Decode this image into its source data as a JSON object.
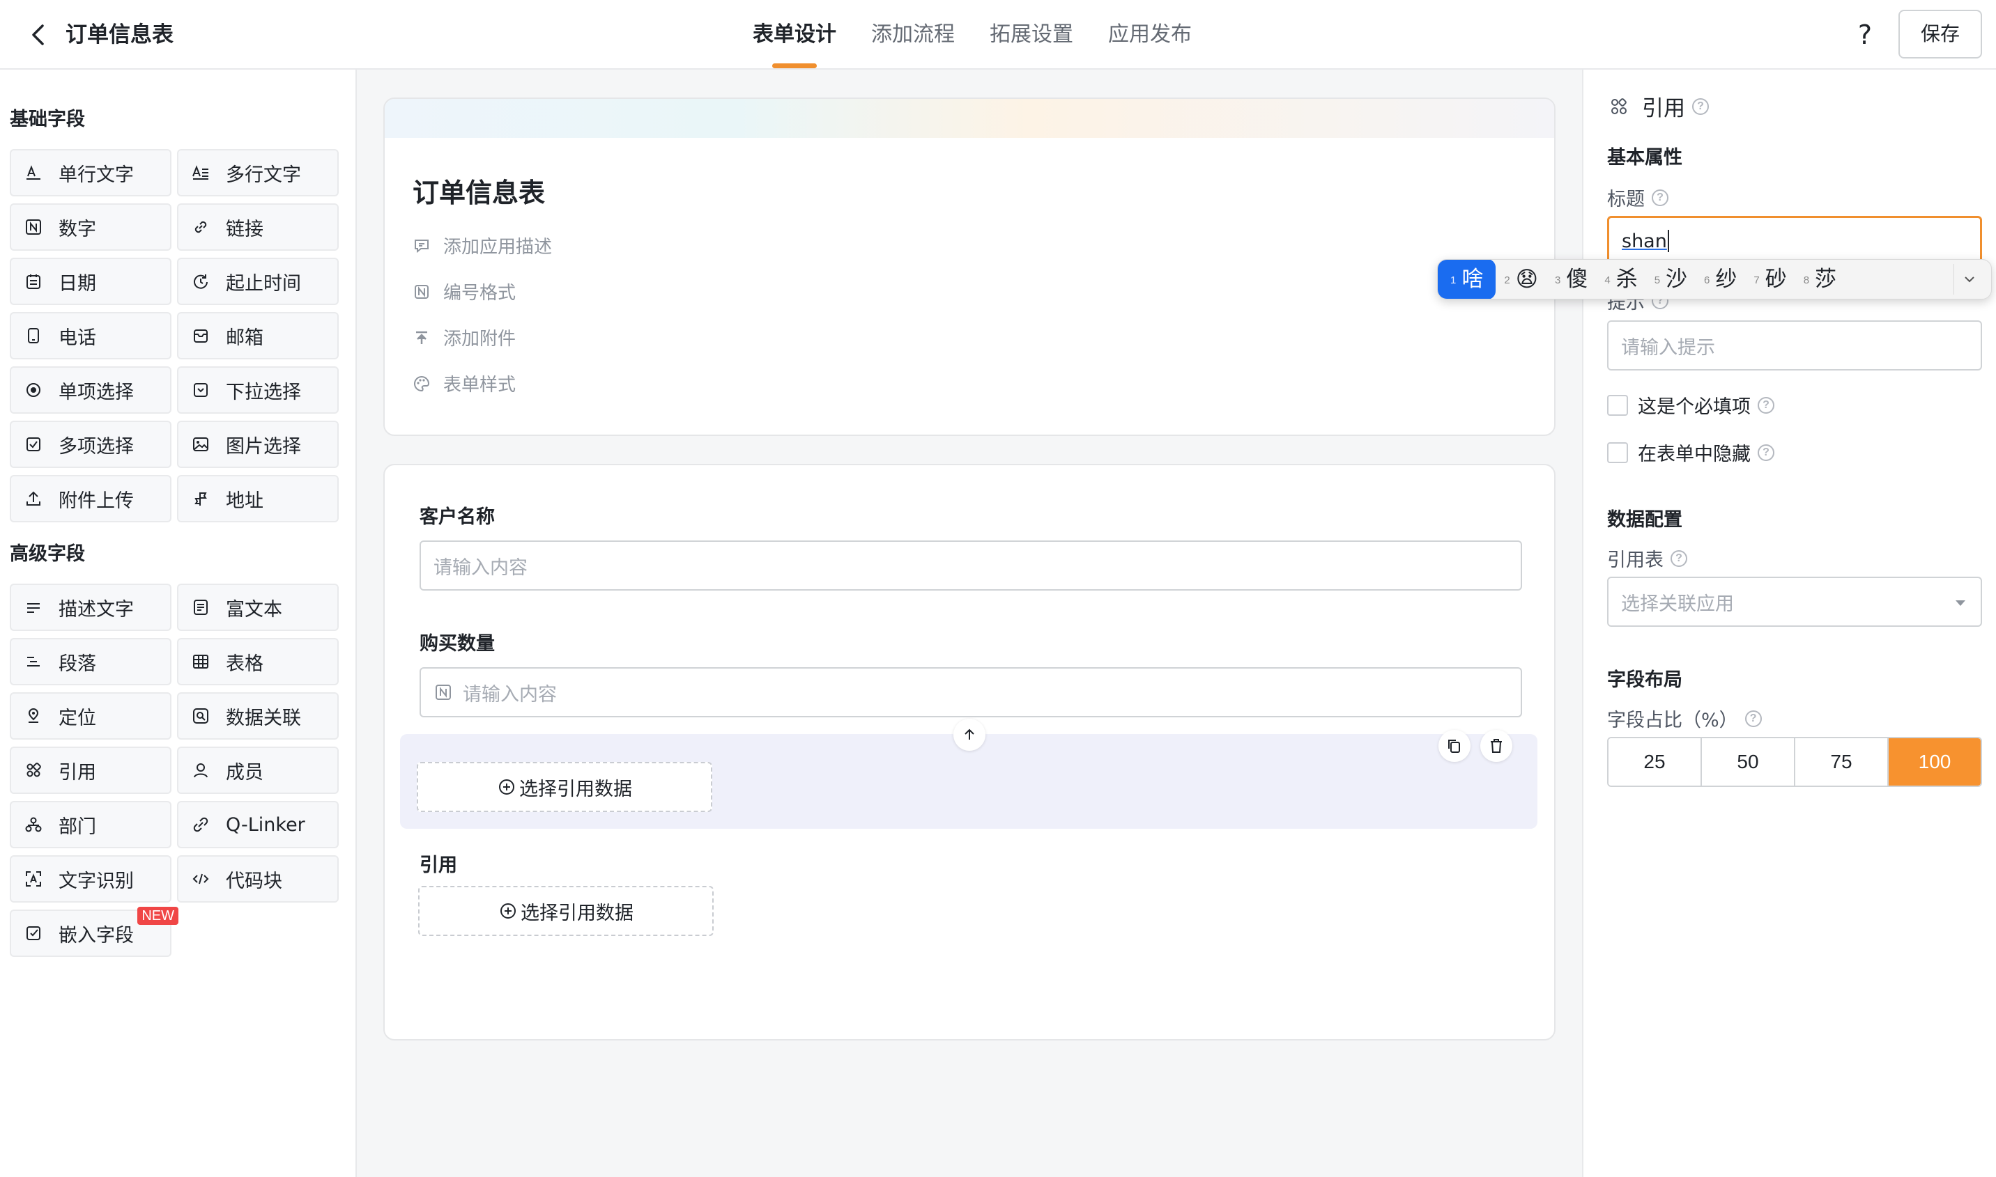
{
  "header": {
    "title": "订单信息表",
    "tabs": [
      {
        "label": "表单设计"
      },
      {
        "label": "添加流程"
      },
      {
        "label": "拓展设置"
      },
      {
        "label": "应用发布"
      }
    ],
    "active_tab": "表单设计",
    "help_label": "?",
    "save_label": "保存"
  },
  "left_panel": {
    "basic_title": "基础字段",
    "basic_fields": [
      {
        "label": "单行文字",
        "icon": "single-line-text-icon"
      },
      {
        "label": "多行文字",
        "icon": "multi-line-text-icon"
      },
      {
        "label": "数字",
        "icon": "number-icon"
      },
      {
        "label": "链接",
        "icon": "link-icon"
      },
      {
        "label": "日期",
        "icon": "calendar-icon"
      },
      {
        "label": "起止时间",
        "icon": "time-range-icon"
      },
      {
        "label": "电话",
        "icon": "phone-icon"
      },
      {
        "label": "邮箱",
        "icon": "mail-icon"
      },
      {
        "label": "单项选择",
        "icon": "radio-icon"
      },
      {
        "label": "下拉选择",
        "icon": "dropdown-icon"
      },
      {
        "label": "多项选择",
        "icon": "checkbox-icon"
      },
      {
        "label": "图片选择",
        "icon": "image-icon"
      },
      {
        "label": "附件上传",
        "icon": "upload-icon"
      },
      {
        "label": "地址",
        "icon": "address-icon"
      }
    ],
    "advanced_title": "高级字段",
    "advanced_fields": [
      {
        "label": "描述文字",
        "icon": "description-icon"
      },
      {
        "label": "富文本",
        "icon": "rich-text-icon"
      },
      {
        "label": "段落",
        "icon": "paragraph-icon"
      },
      {
        "label": "表格",
        "icon": "table-icon"
      },
      {
        "label": "定位",
        "icon": "location-icon"
      },
      {
        "label": "数据关联",
        "icon": "data-link-icon"
      },
      {
        "label": "引用",
        "icon": "reference-icon"
      },
      {
        "label": "成员",
        "icon": "member-icon"
      },
      {
        "label": "部门",
        "icon": "department-icon"
      },
      {
        "label": "Q-Linker",
        "icon": "q-linker-icon"
      },
      {
        "label": "文字识别",
        "icon": "ocr-icon"
      },
      {
        "label": "代码块",
        "icon": "code-icon"
      },
      {
        "label": "嵌入字段",
        "icon": "embed-icon",
        "badge": "NEW"
      }
    ]
  },
  "form_card": {
    "title": "订单信息表",
    "actions": [
      {
        "label": "添加应用描述",
        "icon": "comment-icon"
      },
      {
        "label": "编号格式",
        "icon": "number-format-icon"
      },
      {
        "label": "添加附件",
        "icon": "attachment-upload-icon"
      },
      {
        "label": "表单样式",
        "icon": "palette-icon"
      }
    ]
  },
  "fields_card": {
    "customer_label": "客户名称",
    "customer_placeholder": "请输入内容",
    "quantity_label": "购买数量",
    "quantity_placeholder": "请输入内容",
    "selected_ref_button": "选择引用数据",
    "ref_label": "引用",
    "ref_button": "选择引用数据"
  },
  "right_panel": {
    "header": "引用",
    "basic_section": "基本属性",
    "title_label": "标题",
    "title_value": "shan",
    "hint_label": "提示",
    "hint_placeholder": "请输入提示",
    "required_label": "这是个必填项",
    "hidden_label": "在表单中隐藏",
    "data_section": "数据配置",
    "ref_table_label": "引用表",
    "ref_table_placeholder": "选择关联应用",
    "layout_section": "字段布局",
    "ratio_label": "字段占比（%）",
    "ratio_options": [
      "25",
      "50",
      "75",
      "100"
    ],
    "ratio_selected": "100"
  },
  "ime": {
    "candidates": [
      {
        "num": "1",
        "text": "啥"
      },
      {
        "num": "2",
        "text": "😧"
      },
      {
        "num": "3",
        "text": "傻"
      },
      {
        "num": "4",
        "text": "杀"
      },
      {
        "num": "5",
        "text": "沙"
      },
      {
        "num": "6",
        "text": "纱"
      },
      {
        "num": "7",
        "text": "砂"
      },
      {
        "num": "8",
        "text": "莎"
      }
    ]
  },
  "colors": {
    "accent": "#f7922f",
    "ime_highlight": "#1a6cf0",
    "selected_block": "#eff0fa",
    "badge": "#f04646"
  }
}
